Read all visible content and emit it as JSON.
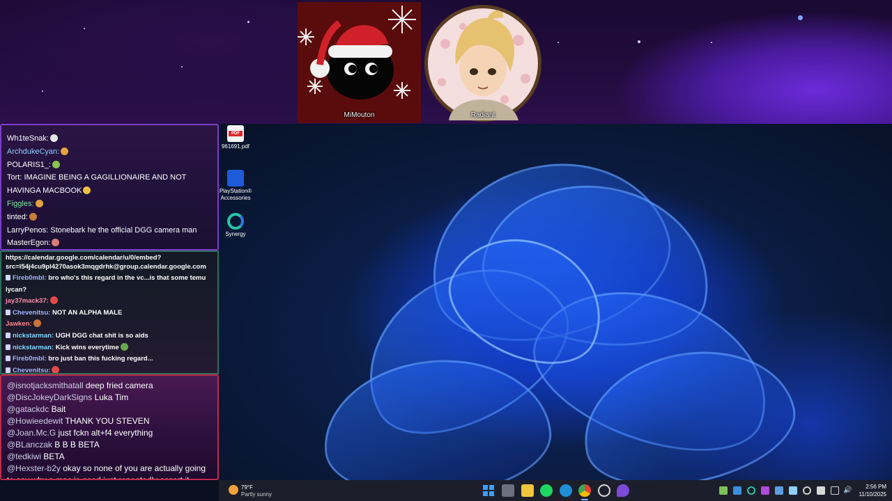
{
  "banner": {
    "cams": [
      {
        "label": "MiMouton"
      },
      {
        "label": "Radiant"
      }
    ]
  },
  "chat1": {
    "messages": [
      {
        "user": "Wh1teSnak:",
        "text": "",
        "user_color": "#ffffff",
        "emote_color": "#e6e6e6"
      },
      {
        "user": "ArchdukeCyan:",
        "text": "",
        "user_color": "#8ad1ff",
        "emote_color": "#e6a23c"
      },
      {
        "user": "POLARIS1_:",
        "text": "",
        "user_color": "#ffffff",
        "emote_color": "#8bc34a"
      },
      {
        "user": "Tort:",
        "text": "IMAGINE BEING A GAGILLIONAIRE AND NOT HAVINGA MACBOOK",
        "user_color": "#ffffff",
        "emote_color": "#f0c040"
      },
      {
        "user": "Figgles:",
        "text": "",
        "user_color": "#7fe0a0",
        "emote_color": "#e6a23c"
      },
      {
        "user": "tinted:",
        "text": "",
        "user_color": "#ffffff",
        "emote_color": "#c77d3a"
      },
      {
        "user": "LarryPenos:",
        "text": "Stonebark he the official DGG camera man",
        "user_color": "#ffffff",
        "emote_color": ""
      },
      {
        "user": "MasterEgon:",
        "text": "",
        "user_color": "#ffffff",
        "emote_color": "#d97c7c"
      }
    ]
  },
  "chat2": {
    "url_line1": "https://calendar.google.com/calendar/u/0/embed?",
    "url_line2": "src=l54j4cu9pl4270asok3mqgdrhk@group.calendar.google.com",
    "messages": [
      {
        "badge": "D",
        "user": "Fireb0mbl:",
        "text": "bro who's this regard in the vc...is that some temu",
        "user_color": "#9fb8ff"
      },
      {
        "badge": "",
        "user": "",
        "text": "lycan?",
        "user_color": "#ffffff"
      },
      {
        "badge": "",
        "user": "jay37mack37:",
        "text": "",
        "user_color": "#ff8fb0",
        "emote_color": "#e04a4a"
      },
      {
        "badge": "D",
        "user": "Chevenitsu:",
        "text": "NOT AN ALPHA MALE",
        "user_color": "#9fb8ff"
      },
      {
        "badge": "",
        "user": "Jawken:",
        "text": "",
        "user_color": "#ff8a8a",
        "emote_color": "#c8743c"
      },
      {
        "badge": "D",
        "user": "nickstarman:",
        "text": "UGH DGG chat shit is so aids",
        "user_color": "#7fd8ff"
      },
      {
        "badge": "D",
        "user": "nickstarman:",
        "text": "Kick wins everytime",
        "user_color": "#7fd8ff",
        "emote_color": "#6aa84f"
      },
      {
        "badge": "D",
        "user": "Fireb0mbl:",
        "text": "bro just ban this fucking regard...",
        "user_color": "#9fb8ff"
      },
      {
        "badge": "D",
        "user": "Chevenitsu:",
        "text": "",
        "user_color": "#9fb8ff",
        "emote_color": "#e04a4a"
      }
    ]
  },
  "chat3": {
    "messages": [
      {
        "user": "@isnotjacksmithatall",
        "text": "deep fried camera"
      },
      {
        "user": "@DiscJokeyDarkSigns",
        "text": "Luka Tim"
      },
      {
        "user": "@gatackdc",
        "text": "Bait"
      },
      {
        "user": "@Howieedewit",
        "text": "THANK YOU STEVEN"
      },
      {
        "user": "@Joan.Mc.G",
        "text": "just fckn alt+f4 everything"
      },
      {
        "user": "@BLanczak",
        "text": "B B B BETA"
      },
      {
        "user": "@tedkiwi",
        "text": "BETA"
      },
      {
        "user": "@Hexster-b2y",
        "text": "okay so none of you are actually going to say why a mac is good just repeatedly assert it"
      }
    ]
  },
  "desktop_icons": [
    {
      "label": "961691.pdf",
      "icon": "pdf-icon"
    },
    {
      "label": "PlayStation® Accessories",
      "icon": "playstation-accessories-icon"
    },
    {
      "label": "Synergy",
      "icon": "synergy-icon"
    }
  ],
  "taskbar": {
    "weather_temp": "79°F",
    "weather_desc": "Partly sunny",
    "time": "2:56 PM",
    "date": "11/10/2025"
  }
}
